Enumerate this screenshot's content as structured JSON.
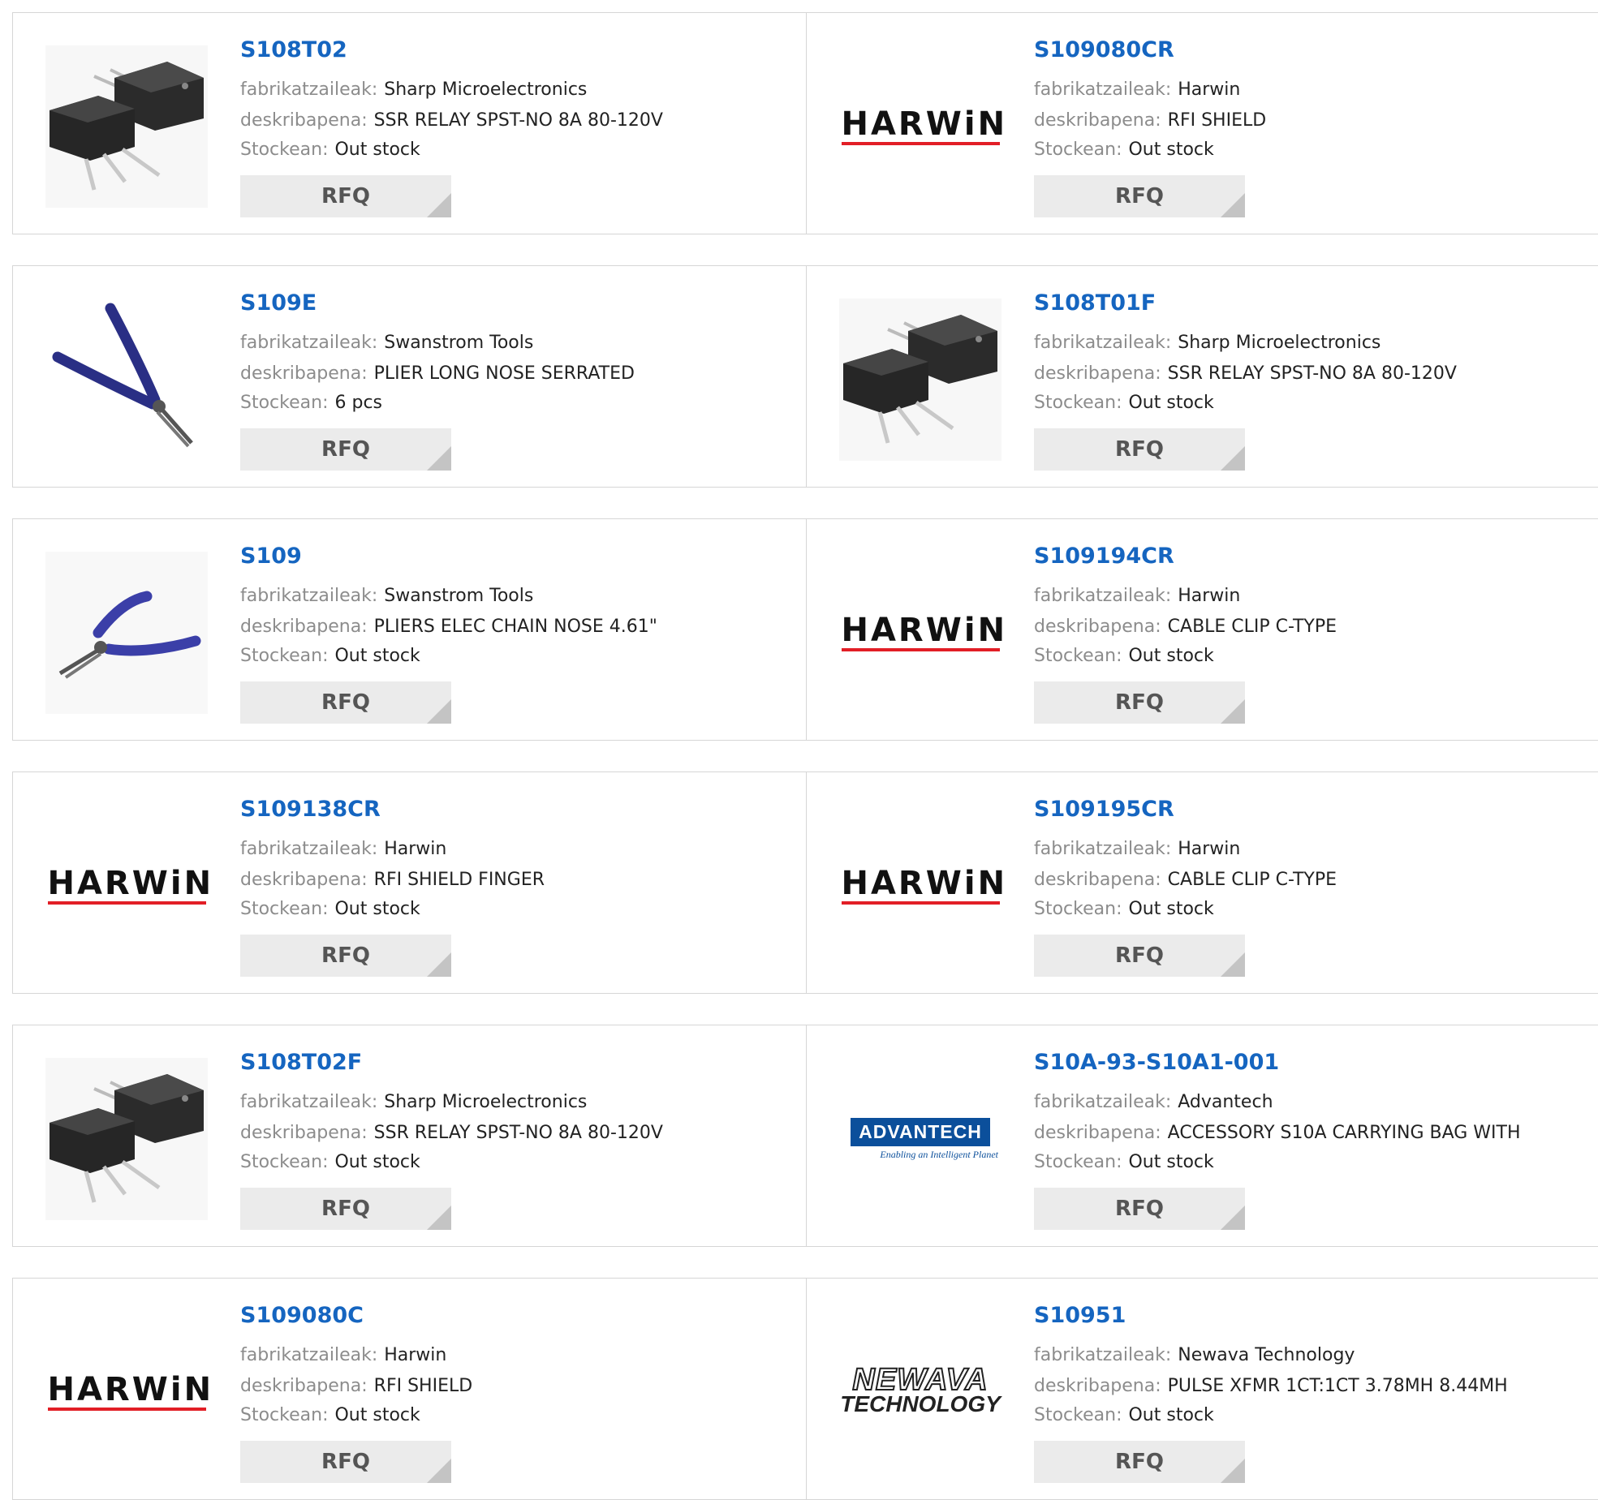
{
  "labels": {
    "manufacturer": "fabrikatzaileak:",
    "description": "deskribapena:",
    "stock": "Stockean:",
    "rfq": "RFQ"
  },
  "colors": {
    "link": "#1565c0",
    "label": "#8c8c8c",
    "harwin_red": "#e21e26",
    "advantech_blue": "#0b4f9b"
  },
  "logos": {
    "harwin": "HARWiN",
    "advantech": "ADVANTECH",
    "advantech_tagline": "Enabling an Intelligent Planet",
    "newava_top": "NEWAVA",
    "newava_bottom": "TECHNOLOGY"
  },
  "products": [
    {
      "part": "S108T02",
      "manufacturer": "Sharp Microelectronics",
      "description": "SSR RELAY SPST-NO 8A 80-120V",
      "stock": "Out stock",
      "image": "ssr-relay-image"
    },
    {
      "part": "S109080CR",
      "manufacturer": "Harwin",
      "description": "RFI SHIELD",
      "stock": "Out stock",
      "image": "harwin-logo"
    },
    {
      "part": "S109E",
      "manufacturer": "Swanstrom Tools",
      "description": "PLIER LONG NOSE SERRATED",
      "stock": "6 pcs",
      "image": "plier-long-nose-image"
    },
    {
      "part": "S108T01F",
      "manufacturer": "Sharp Microelectronics",
      "description": "SSR RELAY SPST-NO 8A 80-120V",
      "stock": "Out stock",
      "image": "ssr-relay-image"
    },
    {
      "part": "S109",
      "manufacturer": "Swanstrom Tools",
      "description": "PLIERS ELEC CHAIN NOSE 4.61\"",
      "stock": "Out stock",
      "image": "plier-chain-nose-image"
    },
    {
      "part": "S109194CR",
      "manufacturer": "Harwin",
      "description": "CABLE CLIP C-TYPE",
      "stock": "Out stock",
      "image": "harwin-logo"
    },
    {
      "part": "S109138CR",
      "manufacturer": "Harwin",
      "description": "RFI SHIELD FINGER",
      "stock": "Out stock",
      "image": "harwin-logo"
    },
    {
      "part": "S109195CR",
      "manufacturer": "Harwin",
      "description": "CABLE CLIP C-TYPE",
      "stock": "Out stock",
      "image": "harwin-logo"
    },
    {
      "part": "S108T02F",
      "manufacturer": "Sharp Microelectronics",
      "description": "SSR RELAY SPST-NO 8A 80-120V",
      "stock": "Out stock",
      "image": "ssr-relay-image"
    },
    {
      "part": "S10A-93-S10A1-001",
      "manufacturer": "Advantech",
      "description": "ACCESSORY S10A CARRYING BAG WITH",
      "stock": "Out stock",
      "image": "advantech-logo"
    },
    {
      "part": "S109080C",
      "manufacturer": "Harwin",
      "description": "RFI SHIELD",
      "stock": "Out stock",
      "image": "harwin-logo"
    },
    {
      "part": "S10951",
      "manufacturer": "Newava Technology",
      "description": "PULSE XFMR 1CT:1CT 3.78MH 8.44MH",
      "stock": "Out stock",
      "image": "newava-logo"
    }
  ]
}
